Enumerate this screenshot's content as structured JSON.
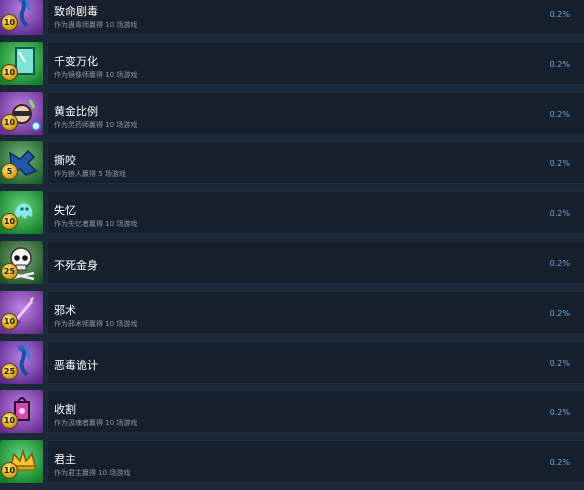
{
  "achievements": [
    {
      "title": "致命剧毒",
      "desc": "作为蛊毒师赢得 10 场游戏",
      "pct": "0.2%",
      "badge": "10",
      "icon": "poison-hydra-icon",
      "color": "#8a3bd6"
    },
    {
      "title": "千变万化",
      "desc": "作为镜像师赢得 10 场游戏",
      "pct": "0.2%",
      "badge": "10",
      "icon": "mirror-icon",
      "color": "#18c23a"
    },
    {
      "title": "黄金比例",
      "desc": "作为灵药师赢得 10 场游戏",
      "pct": "0.2%",
      "badge": "10",
      "icon": "alchemist-icon",
      "color": "#9b44d8"
    },
    {
      "title": "撕咬",
      "desc": "作为狼人赢得 5 场游戏",
      "pct": "0.2%",
      "badge": "5",
      "icon": "werewolf-icon",
      "color": "#2f8f3a"
    },
    {
      "title": "失忆",
      "desc": "作为失忆者赢得 10 场游戏",
      "pct": "0.2%",
      "badge": "10",
      "icon": "ghost-icon",
      "color": "#19c13b"
    },
    {
      "title": "不死金身",
      "desc": "",
      "pct": "0.2%",
      "badge": "25",
      "icon": "skull-icon",
      "color": "#2c7a33"
    },
    {
      "title": "邪术",
      "desc": "作为邪术师赢得 10 场游戏",
      "pct": "0.2%",
      "badge": "10",
      "icon": "dagger-icon",
      "color": "#9b44d8"
    },
    {
      "title": "恶毒诡计",
      "desc": "",
      "pct": "0.2%",
      "badge": "25",
      "icon": "poison-hydra-icon",
      "color": "#8a3bd6"
    },
    {
      "title": "收割",
      "desc": "作为汲魂者赢得 10 场游戏",
      "pct": "0.2%",
      "badge": "10",
      "icon": "lantern-icon",
      "color": "#9b44d8"
    },
    {
      "title": "君主",
      "desc": "作为君主赢得 10 场游戏",
      "pct": "0.2%",
      "badge": "10",
      "icon": "crown-icon",
      "color": "#18c23a"
    }
  ]
}
